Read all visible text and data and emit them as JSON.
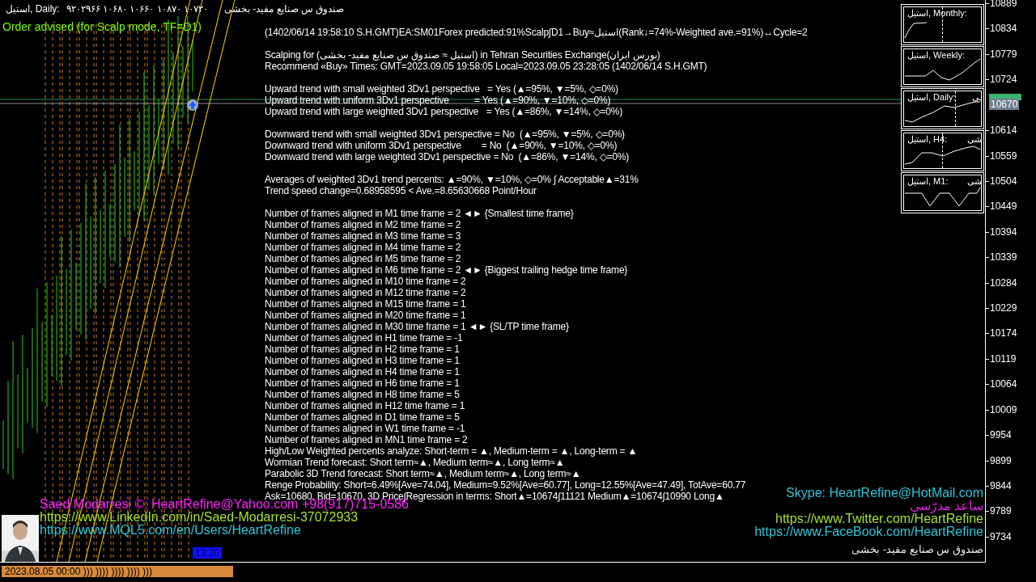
{
  "top_bar": {
    "symbol": "استیل, Daily:",
    "prices": "۹۲۰۲۹۶۶ ۱۰۶۸۰ ۱۰۶۶۰ ۱۰۸۷۰ ۱۰۷۲۰",
    "name": "صندوق س صنایع مفید- بخشی"
  },
  "order_advice": "Order advised (for Scalp mode, TF=D1)",
  "report": [
    {
      "lines": [
        "(1402/06/14 19:58:10 S.H.GMT)EA:SM01Forex predicted:91%Scalp∫D1→Buy≈استیل(Rank↓=74%-Weighted ave.=91%)↔Cycle=2"
      ]
    },
    {
      "lines": [
        "Scalping for (استیل ≈ صندوق س صنایع مفید- بخشی) in Tehran Securities Exchange(بورس ایران)",
        "Recommend «Buy» Times: GMT=2023.09.05 19:58:05 Local=2023.09.05 23:28:05 (1402/06/14 S.H.GMT)"
      ]
    },
    {
      "lines": [
        "Upward trend with small weighted 3Dv1 perspective   = Yes (▲=95%, ▼=5%, ◇=0%)",
        "Upward trend with uniform 3Dv1 perspective          = Yes (▲=90%, ▼=10%, ◇=0%)",
        "Upward trend with large weighted 3Dv1 perspective   = Yes (▲=86%, ▼=14%, ◇=0%)"
      ]
    },
    {
      "lines": [
        "Downward trend with small weighted 3Dv1 perspective = No  (▲=95%, ▼=5%, ◇=0%)",
        "Downward trend with uniform 3Dv1 perspective        = No  (▲=90%, ▼=10%, ◇=0%)",
        "Downward trend with large weighted 3Dv1 perspective = No  (▲=86%, ▼=14%, ◇=0%)"
      ]
    },
    {
      "lines": [
        "Averages of weighted 3Dv1 trend percents: ▲=90%, ▼=10%, ◇=0% ∫ Acceptable▲=31%",
        "Trend speed change=0.68958595 < Ave.=8.65630668 Point/Hour"
      ]
    },
    {
      "lines": [
        "Number of frames aligned in M1 time frame = 2 ◄► {Smallest time frame}",
        "Number of frames aligned in M2 time frame = 2",
        "Number of frames aligned in M3 time frame = 3",
        "Number of frames aligned in M4 time frame = 2",
        "Number of frames aligned in M5 time frame = 2",
        "Number of frames aligned in M6 time frame = 2 ◄► {Biggest trailing hedge time frame}",
        "Number of frames aligned in M10 time frame = 2",
        "Number of frames aligned in M12 time frame = 2",
        "Number of frames aligned in M15 time frame = 1",
        "Number of frames aligned in M20 time frame = 1",
        "Number of frames aligned in M30 time frame = 1 ◄► {SL/TP time frame}",
        "Number of frames aligned in H1 time frame = -1",
        "Number of frames aligned in H2 time frame = 1",
        "Number of frames aligned in H3 time frame = 1",
        "Number of frames aligned in H4 time frame = 1",
        "Number of frames aligned in H6 time frame = 1",
        "Number of frames aligned in H8 time frame = 5",
        "Number of frames aligned in H12 time frame = 1",
        "Number of frames aligned in D1 time frame = 5",
        "Number of frames aligned in W1 time frame = -1",
        "Number of frames aligned in MN1 time frame = 2",
        "High/Low Weighted percents analyze: Short-term = ▲, Medium-term = ▲, Long-term = ▲",
        "Wormian Trend forecast: Short term≈▲, Medium term≈▲, Long term≈▲",
        "Parabolic 3D Trend forecast: Short term≈▲, Medium term≈▲, Long term≈▲",
        "Renge Probability: Short=6.49%[Ave=74.04], Medium=9.52%[Ave=60.77], Long=12.55%[Ave=47.49], TotAve=60.77",
        "Ask=10680, Bid=10670, 3D Price∫Regression in terms: Short▲=10674∫11121 Medium▲=10674∫10990 Long▲"
      ]
    }
  ],
  "mini_charts": [
    {
      "title": "استیل, Monthly:"
    },
    {
      "title": "استیل, Weekly:"
    },
    {
      "title": "استیل, Daily:",
      "tail": "ـی"
    },
    {
      "title": "استیل, H4:",
      "tail": "شی"
    },
    {
      "title": "استیل, M1:",
      "tail": "شی"
    }
  ],
  "price_axis": [
    "10889",
    "10834",
    "10779",
    "10724",
    "10614",
    "10559",
    "10504",
    "10449",
    "10394",
    "10339",
    "10284",
    "10229",
    "10174",
    "10119",
    "10064",
    "10009",
    "9954",
    "9899",
    "9844",
    "9789",
    "9734"
  ],
  "bid_tag": "10670",
  "time_tag": "13:20",
  "time_axis": "2023.08.05 00:00 ))) )))) )))) )))) )))",
  "contacts_left": [
    {
      "text": "Saed Modarresi ©: HeartRefine@Yahoo.com +98(917)715-0586",
      "color": "#ff22ff"
    },
    {
      "text": "https://www.LinkedIn.com/in/Saed-Modarresi-37072933",
      "color": "#a6e22e"
    },
    {
      "text": "https://www.MQL5.com/en/Users/HeartRefine",
      "color": "#2cc6d6"
    }
  ],
  "contacts_right": [
    {
      "text": "Skype: HeartRefine@HotMail.com",
      "color": "#2cc6d6"
    },
    {
      "text": "ساعد مدرّسی",
      "color": "#e020e0"
    },
    {
      "text": "https://www.Twitter.com/HeartRefine",
      "color": "#a6e22e"
    },
    {
      "text": "https://www.FaceBook.com/HeartRefine",
      "color": "#2cc6d6"
    },
    {
      "text": "صندوق س صنایع مفید- بخشی",
      "color": "#e8e8e8"
    }
  ]
}
